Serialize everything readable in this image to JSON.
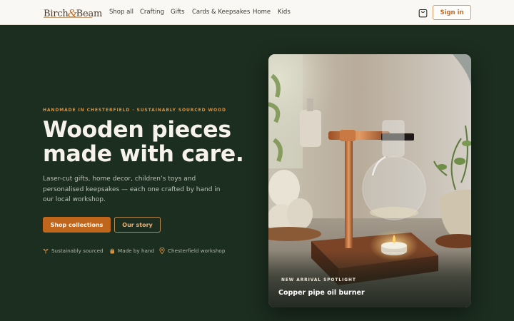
{
  "brand": {
    "name_first": "Birch",
    "ampersand": "&",
    "name_second": "Beam"
  },
  "nav": {
    "items": [
      {
        "label": "Shop all"
      },
      {
        "label": "Crafting"
      },
      {
        "label": "Gifts"
      },
      {
        "label": "Cards & Keepsakes"
      },
      {
        "label": "Home"
      },
      {
        "label": "Kids"
      }
    ],
    "cart_icon": "shopping-bag-icon",
    "sign_in_label": "Sign in"
  },
  "hero": {
    "eyebrow": "HANDMADE IN CHESTERFIELD · SUSTAINABLY SOURCED WOOD",
    "headline_line1": "Wooden pieces",
    "headline_line2": "made with care.",
    "subcopy": "Laser-cut gifts, home decor, children’s toys and personalised keepsakes — each one crafted by hand in our local workshop.",
    "primary_cta": "Shop collections",
    "secondary_cta": "Our story",
    "features": [
      {
        "icon": "sprout-icon",
        "label": "Sustainably sourced"
      },
      {
        "icon": "hand-icon",
        "label": "Made by hand"
      },
      {
        "icon": "map-pin-icon",
        "label": "Chesterfield workshop"
      }
    ]
  },
  "spotlight": {
    "eyebrow": "NEW ARRIVAL SPOTLIGHT",
    "title": "Copper pipe oil burner"
  },
  "colors": {
    "hero_bg": "#1c2e1f",
    "accent": "#c0661c",
    "eyebrow": "#d9913f",
    "header_bg": "#faf8f4"
  }
}
